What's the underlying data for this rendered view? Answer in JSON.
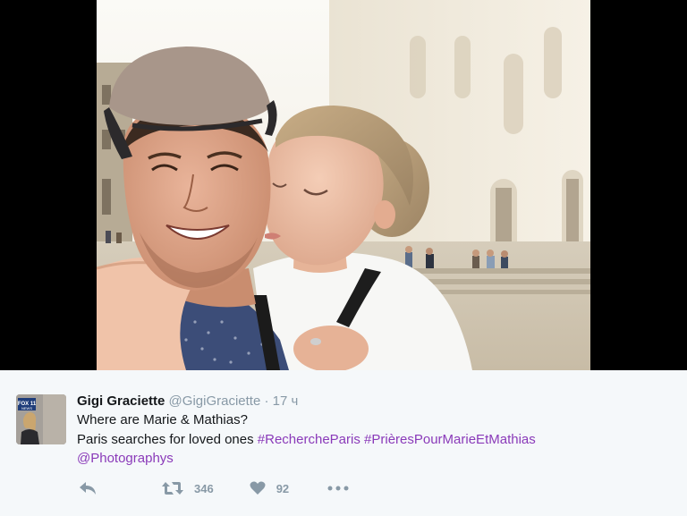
{
  "tweet": {
    "display_name": "Gigi Graciette",
    "handle": "@GigiGraciette",
    "separator": "·",
    "time": "17 ч",
    "text_line1": "Where are Marie & Mathias?",
    "text_line2_prefix": "Paris searches for loved ones ",
    "hashtag1": "#RecherchePari",
    "hashtag1_tail": "s",
    "hashtag2": "#PrièresPourMarieEtMathias",
    "mention": "@Photographys"
  },
  "avatar": {
    "badge_text": "FOX 11",
    "badge_sub": "NEWS"
  },
  "actions": {
    "retweet_count": "346",
    "like_count": "92"
  },
  "icons": {
    "reply": "reply-icon",
    "retweet": "retweet-icon",
    "like": "heart-icon",
    "more": "more-icon"
  },
  "colors": {
    "link": "#8a3ab9",
    "meta": "#8899a6",
    "text": "#14171a",
    "background": "#f5f8fa"
  }
}
